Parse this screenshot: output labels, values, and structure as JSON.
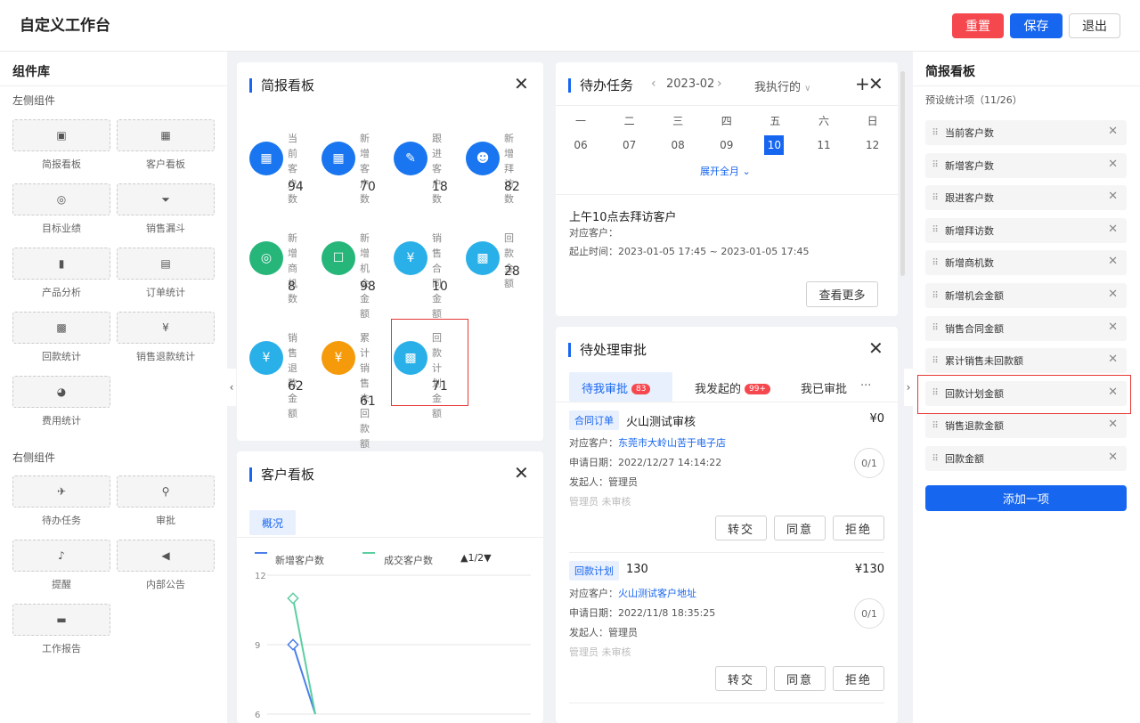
{
  "header": {
    "title": "自定义工作台",
    "reset": "重置",
    "save": "保存",
    "exit": "退出",
    "reset_color": "#f5484e",
    "save_color": "#1766f0"
  },
  "library": {
    "title": "组件库",
    "left_section": "左侧组件",
    "right_section": "右侧组件",
    "left_items": [
      {
        "label": "简报看板",
        "icon": "presentation-icon"
      },
      {
        "label": "客户看板",
        "icon": "building-icon"
      },
      {
        "label": "目标业绩",
        "icon": "target-icon"
      },
      {
        "label": "销售漏斗",
        "icon": "funnel-icon"
      },
      {
        "label": "产品分析",
        "icon": "bar-chart-icon"
      },
      {
        "label": "订单统计",
        "icon": "clipboard-icon"
      },
      {
        "label": "回款统计",
        "icon": "calendar-icon"
      },
      {
        "label": "销售退款统计",
        "icon": "refund-icon"
      },
      {
        "label": "费用统计",
        "icon": "pie-chart-icon"
      }
    ],
    "right_items": [
      {
        "label": "待办任务",
        "icon": "pin-icon"
      },
      {
        "label": "审批",
        "icon": "stamp-icon"
      },
      {
        "label": "提醒",
        "icon": "bell-icon"
      },
      {
        "label": "内部公告",
        "icon": "speaker-icon"
      },
      {
        "label": "工作报告",
        "icon": "document-icon"
      }
    ]
  },
  "briefing": {
    "title": "简报看板",
    "close": "✕",
    "stats": [
      {
        "label": "当前客户数",
        "value": "94",
        "color": "#1976f0",
        "icon": "building-icon"
      },
      {
        "label": "新增客户数",
        "value": "70",
        "color": "#1976f0",
        "icon": "building-icon"
      },
      {
        "label": "跟进客户数",
        "value": "18",
        "color": "#1976f0",
        "icon": "pen-icon"
      },
      {
        "label": "新增拜访数",
        "value": "82",
        "color": "#1976f0",
        "icon": "users-icon"
      },
      {
        "label": "新增商机数",
        "value": "8",
        "color": "#26b67a",
        "icon": "target-icon"
      },
      {
        "label": "新增机会金额",
        "value": "98",
        "color": "#26b67a",
        "icon": "opportunity-icon"
      },
      {
        "label": "销售合同金额",
        "value": "10",
        "color": "#2ab0e8",
        "icon": "contract-icon"
      },
      {
        "label": "回款金额",
        "value": "28",
        "color": "#2ab0e8",
        "icon": "calendar-icon"
      },
      {
        "label": "销售退款金额",
        "value": "62",
        "color": "#2ab0e8",
        "icon": "refund-icon"
      },
      {
        "label": "累计销售未回款额",
        "value": "61",
        "color": "#f59a0a",
        "icon": "yen-icon"
      },
      {
        "label": "回款计划金额",
        "value": "71",
        "color": "#2ab0e8",
        "icon": "calendar-icon"
      }
    ]
  },
  "customer": {
    "title": "客户看板",
    "tab": "概况",
    "legend": [
      {
        "name": "新增客户数",
        "color": "#4a7ee8"
      },
      {
        "name": "成交客户数",
        "color": "#5ccfa2"
      }
    ],
    "pager": "1/2",
    "chart_data": {
      "type": "line",
      "yticks": [
        "12",
        "9",
        "6"
      ],
      "ylim": [
        6,
        12
      ],
      "series": [
        {
          "name": "新增客户数",
          "values": [
            9,
            6
          ]
        },
        {
          "name": "成交客户数",
          "values": [
            11,
            6
          ]
        }
      ]
    }
  },
  "tasks": {
    "title": "待办任务",
    "month": "2023-02",
    "filter": "我执行的",
    "weekdays": [
      "一",
      "二",
      "三",
      "四",
      "五",
      "六",
      "日"
    ],
    "days": [
      "06",
      "07",
      "08",
      "09",
      "10",
      "11",
      "12"
    ],
    "selected": "10",
    "expand": "展开全月",
    "event_title": "上午10点去拜访客户",
    "customer_label": "对应客户：",
    "time_label": "起止时间：2023-01-05 17:45 ~ 2023-01-05 17:45",
    "more": "查看更多"
  },
  "approval": {
    "title": "待处理审批",
    "tabs": [
      {
        "label": "待我审批",
        "badge": "83"
      },
      {
        "label": "我发起的",
        "badge": "99+"
      },
      {
        "label": "我已审批",
        "badge": ""
      }
    ],
    "more": "···",
    "items": [
      {
        "tag": "合同订单",
        "name": "火山测试审核",
        "amount": "¥0",
        "customer_label": "对应客户：",
        "customer": "东莞市大岭山苦于电子店",
        "date": "申请日期：2022/12/27 14:14:22",
        "initiator": "发起人：管理员",
        "status": "管理员 未审核",
        "progress": "0/1"
      },
      {
        "tag": "回款计划",
        "name": "130",
        "amount": "¥130",
        "customer_label": "对应客户：",
        "customer": "火山测试客户地址",
        "date": "申请日期：2022/11/8 18:35:25",
        "initiator": "发起人：管理员",
        "status": "管理员 未审核",
        "progress": "0/1"
      }
    ],
    "actions": [
      "转交",
      "同意",
      "拒绝"
    ]
  },
  "right_panel": {
    "title": "简报看板",
    "subtitle": "预设统计项（11/26）",
    "items": [
      "当前客户数",
      "新增客户数",
      "跟进客户数",
      "新增拜访数",
      "新增商机数",
      "新增机会金额",
      "销售合同金额",
      "累计销售未回款额",
      "回款计划金额",
      "销售退款金额",
      "回款金额"
    ],
    "add": "添加一项"
  }
}
